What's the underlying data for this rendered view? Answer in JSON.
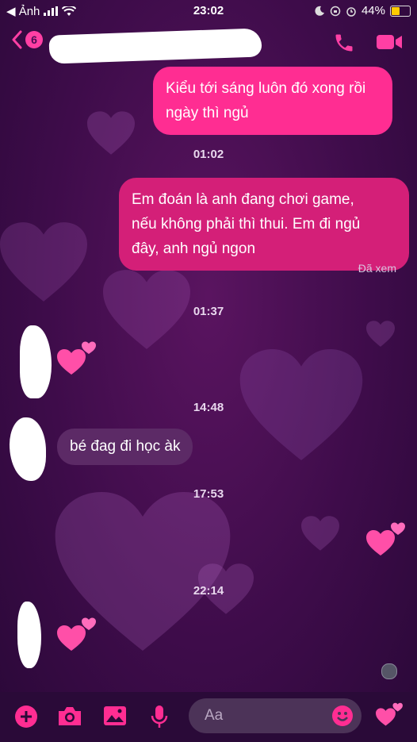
{
  "status_bar": {
    "back_app": "◀ Ảnh",
    "time": "23:02",
    "battery": "44%"
  },
  "header": {
    "back_count": "6"
  },
  "messages": [
    {
      "id": "m1",
      "direction": "outgoing",
      "text_lines": [
        "Kiểu tới sáng luôn đó xong rồi",
        "ngày thì ngủ"
      ]
    },
    {
      "id": "t1",
      "type": "timestamp",
      "text": "01:02"
    },
    {
      "id": "m2",
      "direction": "outgoing",
      "text_lines": [
        "Em đoán là anh đang chơi game,",
        "nếu không phải thì thui. Em đi ngủ",
        "đây, anh ngủ ngon"
      ]
    },
    {
      "id": "s1",
      "type": "status",
      "text": "Đã xem"
    },
    {
      "id": "t2",
      "type": "timestamp",
      "text": "01:37"
    },
    {
      "id": "t3",
      "type": "timestamp",
      "text": "14:48"
    },
    {
      "id": "m3",
      "direction": "incoming",
      "text": "bé đag đi học àk"
    },
    {
      "id": "t4",
      "type": "timestamp",
      "text": "17:53"
    },
    {
      "id": "t5",
      "type": "timestamp",
      "text": "22:14"
    }
  ],
  "composer": {
    "placeholder": "Aa"
  },
  "colors": {
    "accent": "#ff2d92",
    "background": "#3e0c4a",
    "incoming_bubble": "#5c2a66"
  },
  "icons": [
    "back-chevron-icon",
    "phone-icon",
    "video-camera-icon",
    "plus-icon",
    "camera-icon",
    "image-icon",
    "microphone-icon",
    "emoji-icon",
    "hearts-icon"
  ]
}
